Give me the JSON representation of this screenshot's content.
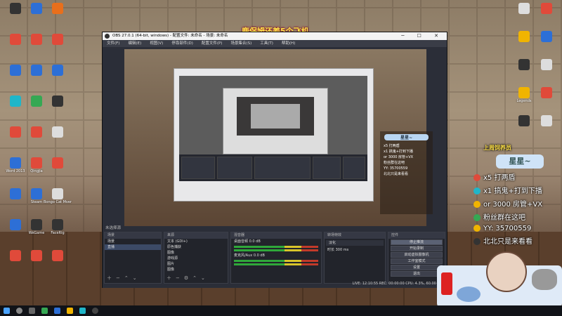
{
  "desktop": {
    "icons_left": [
      {
        "label": "",
        "color": "c7"
      },
      {
        "label": "",
        "color": "c1"
      },
      {
        "label": "",
        "color": "c9"
      },
      {
        "label": "",
        "color": "c2"
      },
      {
        "label": "",
        "color": "c2"
      },
      {
        "label": "",
        "color": "c2"
      },
      {
        "label": "",
        "color": "c1"
      },
      {
        "label": "",
        "color": "c1"
      },
      {
        "label": "",
        "color": "c1"
      },
      {
        "label": "",
        "color": "c6"
      },
      {
        "label": "",
        "color": "c3"
      },
      {
        "label": "",
        "color": "c7"
      },
      {
        "label": "",
        "color": "c2"
      },
      {
        "label": "",
        "color": "c2"
      },
      {
        "label": "",
        "color": "c8"
      },
      {
        "label": "Word 2013",
        "color": "c1"
      },
      {
        "label": "Qingjia",
        "color": "c2"
      },
      {
        "label": "",
        "color": "c2"
      },
      {
        "label": "",
        "color": "c1"
      },
      {
        "label": "Steam",
        "color": "c1"
      },
      {
        "label": "Bongo Cat Mver",
        "color": "c8"
      },
      {
        "label": "",
        "color": "c1"
      },
      {
        "label": "WeGame",
        "color": "c7"
      },
      {
        "label": "FaceRig",
        "color": "c7"
      },
      {
        "label": "",
        "color": "c2"
      },
      {
        "label": "",
        "color": "c2"
      },
      {
        "label": "",
        "color": "c2"
      }
    ],
    "icons_right": [
      {
        "label": "",
        "color": "c8"
      },
      {
        "label": "",
        "color": "c2"
      },
      {
        "label": "",
        "color": "c4"
      },
      {
        "label": "",
        "color": "c1"
      },
      {
        "label": "",
        "color": "c7"
      },
      {
        "label": "",
        "color": "c8"
      },
      {
        "label": "Legends",
        "color": "c4"
      },
      {
        "label": "",
        "color": "c2"
      },
      {
        "label": "",
        "color": "c7"
      },
      {
        "label": "",
        "color": "c8"
      }
    ]
  },
  "overlay_title": "鹿保姆还差5个飞机",
  "obs": {
    "title": "OBS 27.0.1 (64-bit, windows) - 配置文件: 未命名 - 场景: 未命名",
    "window_controls": "─ ☐ ✕",
    "menu": [
      "文件(F)",
      "编辑(E)",
      "视图(V)",
      "停靠部件(D)",
      "配置文件(P)",
      "场景集合(S)",
      "工具(T)",
      "帮助(H)"
    ],
    "docks": {
      "no_source": "未选择源",
      "scenes": {
        "header": "场景",
        "items": [
          "场景",
          "直播"
        ]
      },
      "sources": {
        "header": "来源",
        "items": [
          "文本 (GDI+)",
          "原色捕获",
          "图像",
          "游戏源",
          "图片",
          "图像"
        ]
      },
      "mixer": {
        "header": "混音器",
        "items": [
          {
            "name": "桌面音频",
            "value": "0.0 dB"
          },
          {
            "name": "麦克风/Aux",
            "value": "0.0 dB"
          }
        ]
      },
      "transitions": {
        "header": "转场特效",
        "mode": "淡化",
        "duration_label": "时长",
        "duration": "300 ms"
      },
      "controls": {
        "header": "控件",
        "buttons": [
          "停止推流",
          "开始录制",
          "启动虚拟摄像机",
          "工作室模式",
          "设置",
          "退出"
        ]
      }
    },
    "status": "LIVE: 12:10:55  REC: 00:00:00  CPU: 4.3%, 60.00 fps"
  },
  "promo": {
    "title": "上周饲养员",
    "name": "星星~",
    "lines": [
      {
        "text": "x5 打两盾",
        "mark": "c2"
      },
      {
        "text": "x1 搞鬼+打到下播",
        "mark": "c6"
      },
      {
        "text": "or 3000 房管+VX",
        "mark": "c4"
      },
      {
        "text": "粉丝群在这吧",
        "mark": "c3"
      },
      {
        "text": "YY: 35700559",
        "mark": "c4"
      },
      {
        "text": "北北只是来看看",
        "mark": "c7"
      }
    ]
  },
  "promo_mini": {
    "name": "星星~",
    "lines": [
      "x5 打两盾",
      "x1 搞鬼+打到下播",
      "or 3000 房管+VX",
      "粉丝群在这吧",
      "YY: 35700559",
      "北北只是来看看"
    ]
  }
}
